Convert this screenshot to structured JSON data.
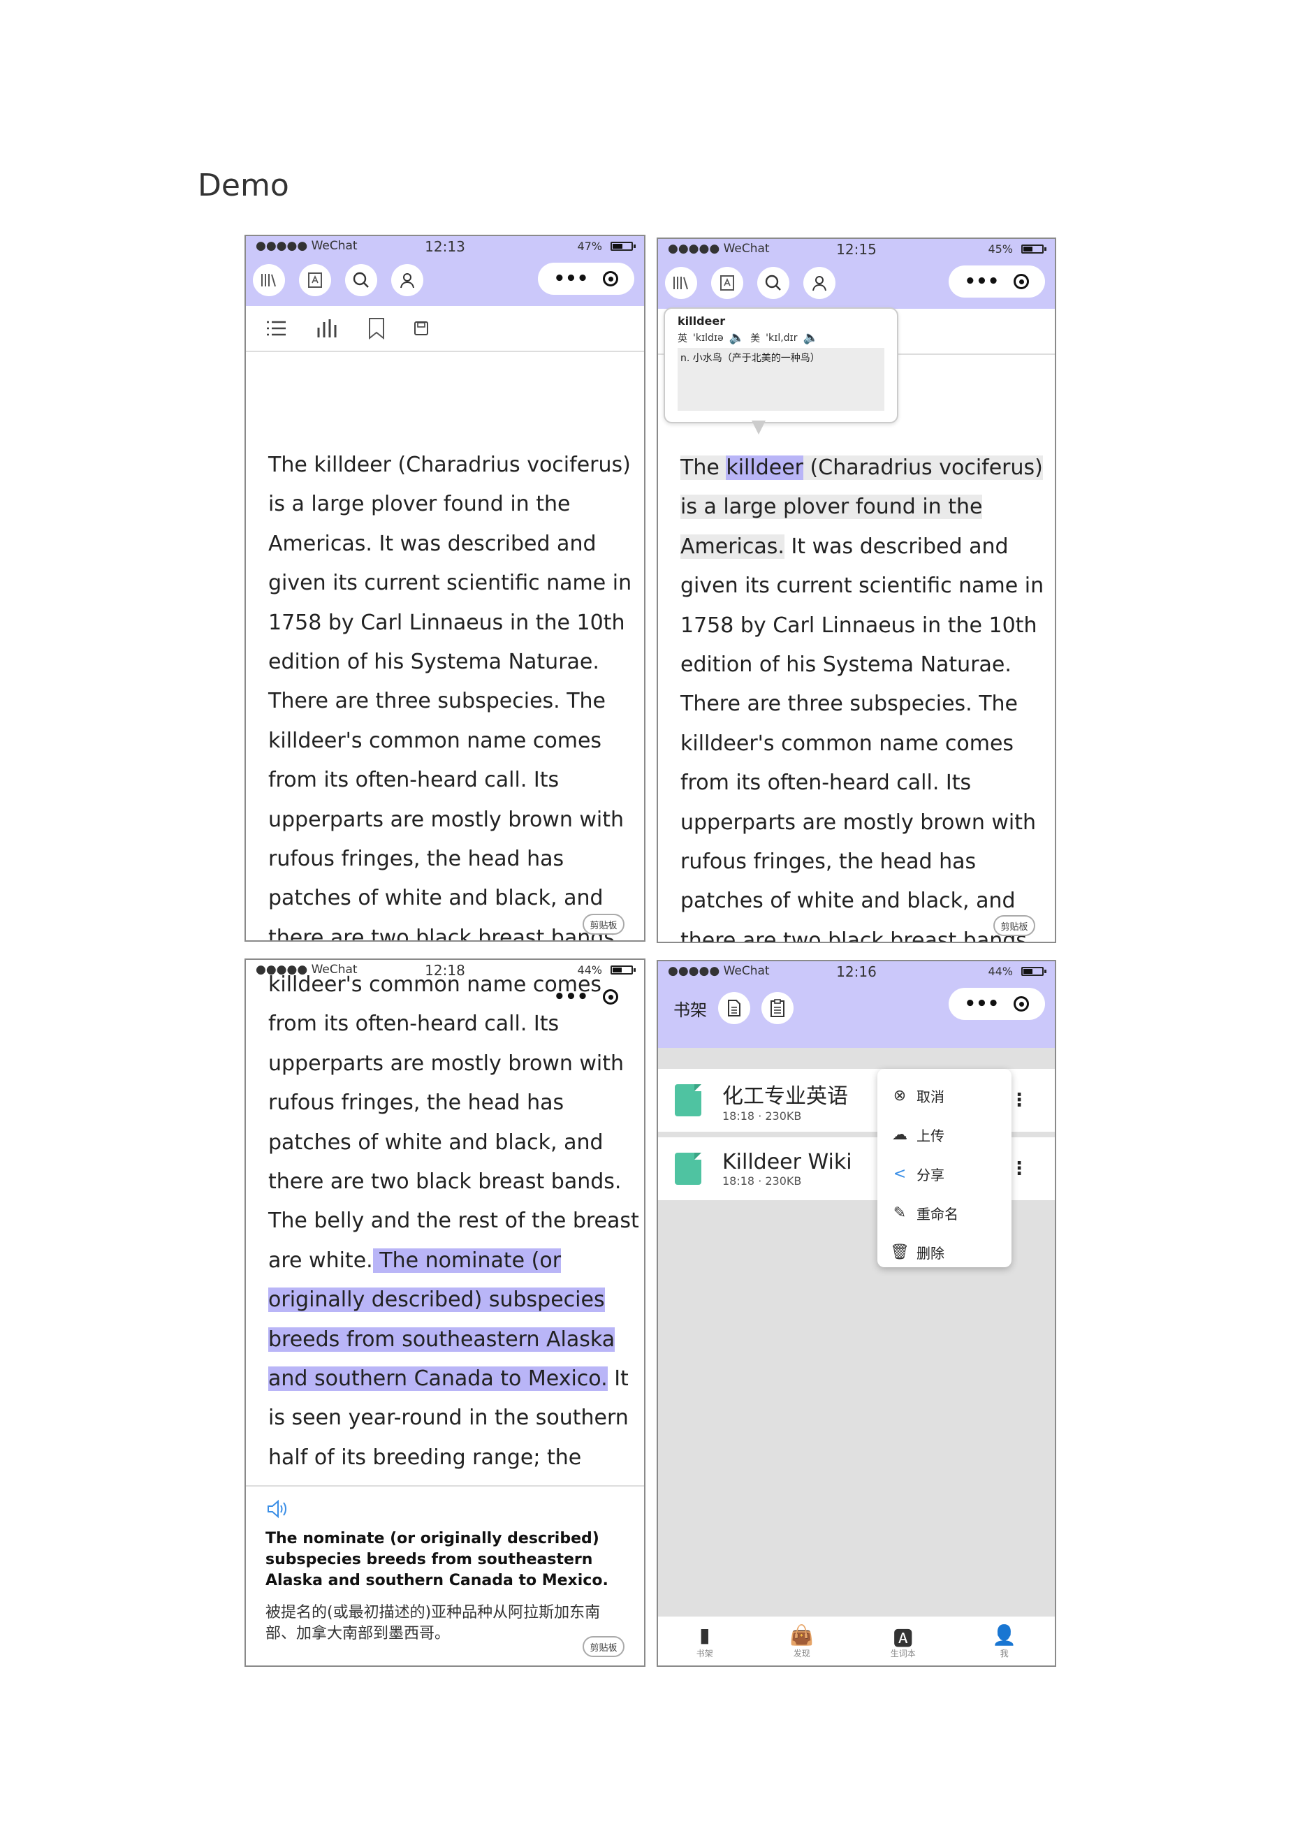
{
  "title": "Demo",
  "phone1": {
    "carrier": "●●●●● WeChat",
    "time": "12:13",
    "battery": "47%",
    "reading_lines": [
      "The killdeer (Charadrius vociferus)",
      "is a large plover found in the",
      "Americas. It was described and",
      "given its current scientific name in",
      "1758 by Carl Linnaeus in the 10th",
      "edition of his Systema Naturae.",
      "There are three subspecies. The",
      "killdeer's common name comes",
      "from its often-heard call. Its",
      "upperparts are mostly brown with",
      "rufous fringes, the head has",
      "patches of white and black, and",
      "there are two black breast bands."
    ],
    "clipboard": "剪贴板"
  },
  "phone2": {
    "carrier": "●●●●● WeChat",
    "time": "12:15",
    "battery": "45%",
    "dict": {
      "word": "killdeer",
      "uk_label": "英",
      "uk_phonetic": "'kɪldɪə",
      "us_label": "美",
      "us_phonetic": "'kɪl,dɪr",
      "definition": "n. 小水鸟（产于北美的一种鸟）"
    },
    "line0_pre": "The ",
    "line0_word": "killdeer",
    "line0_post": " (Charadrius vociferus)",
    "line1": "is a large plover found in the",
    "line2_hl": "Americas.",
    "line2_post": " It was described and",
    "reading_lines": [
      "given its current scientific name in",
      "1758 by Carl Linnaeus in the 10th",
      "edition of his Systema Naturae.",
      "There are three subspecies. The",
      "killdeer's common name comes",
      "from its often-heard call. Its",
      "upperparts are mostly brown with",
      "rufous fringes, the head has",
      "patches of white and black, and",
      "there are two black breast bands."
    ],
    "clipboard": "剪贴板"
  },
  "phone3": {
    "carrier": "●●●●● WeChat",
    "time": "12:18",
    "battery": "44%",
    "reading_lines": [
      "killdeer's common name comes",
      "from its often-heard call. Its",
      "upperparts are mostly brown with",
      "rufous fringes, the head has",
      "patches of white and black, and",
      "there are two black breast bands.",
      "The belly and the rest of the breast"
    ],
    "line7_pre": "are white.",
    "line7_hl": " The nominate (or",
    "line8_hl": "originally described) subspecies",
    "line9_hl": "breeds from southeastern Alaska",
    "line10_hl": "and southern Canada to Mexico.",
    "line10_post": " It",
    "line11": "is seen year-round in the southern",
    "line12": "half of its breeding range; the",
    "translation_en": "The nominate (or originally described) subspecies breeds from southeastern Alaska and southern Canada to Mexico.",
    "translation_zh": "被提名的(或最初描述的)亚种品种从阿拉斯加东南部、加拿大南部到墨西哥。",
    "clipboard": "剪贴板"
  },
  "phone4": {
    "carrier": "●●●●● WeChat",
    "time": "12:16",
    "battery": "44%",
    "header_title": "书架",
    "files": [
      {
        "name": "化工专业英语",
        "meta": "18:18 · 230KB"
      },
      {
        "name": "Killdeer Wiki",
        "meta": "18:18 · 230KB"
      }
    ],
    "menu": [
      {
        "icon": "cancel-icon",
        "label": "取消"
      },
      {
        "icon": "cloud-upload-icon",
        "label": "上传"
      },
      {
        "icon": "share-icon",
        "label": "分享"
      },
      {
        "icon": "pencil-icon",
        "label": "重命名"
      },
      {
        "icon": "trash-icon",
        "label": "删除"
      }
    ],
    "tabs": [
      "书架",
      "发现",
      "生词本",
      "我"
    ]
  },
  "colors": {
    "header": "#cbc8fa",
    "highlight": "#b9b5f7",
    "file_icon": "#4fc3a1",
    "speaker": "#3a8ee6"
  }
}
